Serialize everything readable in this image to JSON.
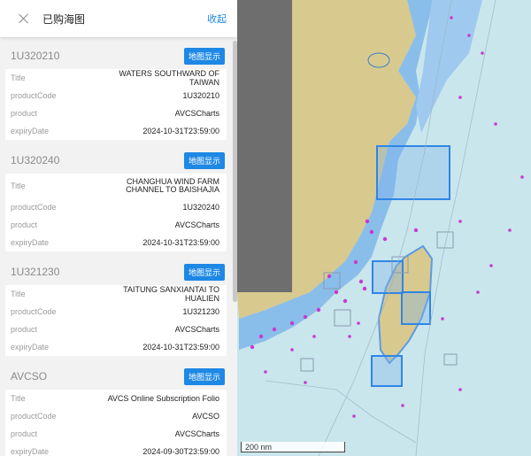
{
  "panel": {
    "title": "已购海图",
    "collapse_label": "收起",
    "show_on_map_label": "地图显示",
    "field_labels": {
      "title": "Title",
      "product_code": "productCode",
      "product": "product",
      "expiry_date": "expiryDate"
    },
    "items": [
      {
        "code": "1U320210",
        "title": "WATERS SOUTHWARD OF TAIWAN",
        "product_code": "1U320210",
        "product": "AVCSCharts",
        "expiry_date": "2024-10-31T23:59:00"
      },
      {
        "code": "1U320240",
        "title": "CHANGHUA WIND FARM CHANNEL TO BAISHAJIA",
        "product_code": "1U320240",
        "product": "AVCSCharts",
        "expiry_date": "2024-10-31T23:59:00"
      },
      {
        "code": "1U321230",
        "title": "TAITUNG SANXIANTAI TO HUALIEN",
        "product_code": "1U321230",
        "product": "AVCSCharts",
        "expiry_date": "2024-10-31T23:59:00"
      },
      {
        "code": "AVCSO",
        "title": "AVCS Online Subscription Folio",
        "product_code": "AVCSO",
        "product": "AVCSCharts",
        "expiry_date": "2024-09-30T23:59:00"
      }
    ]
  },
  "map": {
    "scale_label": "200 nm",
    "colors": {
      "sea": "#c9e6ec",
      "land": "#d8c98e",
      "shallow": "#7fb6ea",
      "highlight": "#3b8de6",
      "dark": "#6e6e6e",
      "marker": "#c63ad1"
    }
  }
}
